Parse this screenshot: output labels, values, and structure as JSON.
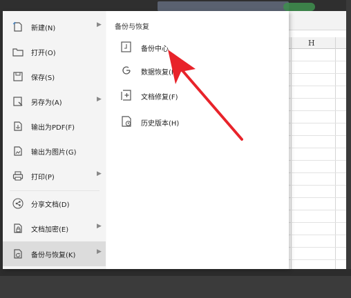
{
  "sheet": {
    "column_letter": "H"
  },
  "menu": {
    "items": [
      {
        "label": "新建(N)",
        "icon": "new-file-icon",
        "has_submenu": true
      },
      {
        "label": "打开(O)",
        "icon": "folder-icon",
        "has_submenu": false
      },
      {
        "label": "保存(S)",
        "icon": "save-icon",
        "has_submenu": false
      },
      {
        "label": "另存为(A)",
        "icon": "save-as-icon",
        "has_submenu": true
      },
      {
        "label": "输出为PDF(F)",
        "icon": "export-pdf-icon",
        "has_submenu": false
      },
      {
        "label": "输出为图片(G)",
        "icon": "export-image-icon",
        "has_submenu": false
      },
      {
        "label": "打印(P)",
        "icon": "printer-icon",
        "has_submenu": true
      },
      {
        "label": "分享文档(D)",
        "icon": "share-icon",
        "has_submenu": false
      },
      {
        "label": "文档加密(E)",
        "icon": "encrypt-icon",
        "has_submenu": true
      },
      {
        "label": "备份与恢复(K)",
        "icon": "backup-restore-icon",
        "has_submenu": true,
        "active": true
      }
    ],
    "submenu": {
      "title": "备份与恢复",
      "items": [
        {
          "label": "备份中心",
          "icon": "backup-center-icon"
        },
        {
          "label": "数据恢复(R)",
          "icon": "data-recovery-icon"
        },
        {
          "label": "文档修复(F)",
          "icon": "document-repair-icon"
        },
        {
          "label": "历史版本(H)",
          "icon": "history-version-icon"
        }
      ]
    }
  },
  "colors": {
    "menu_left_bg": "#f4f4f4",
    "active_item_bg": "#dcdcdc",
    "annotation_arrow": "#e8232a",
    "window_frame": "#2f2f2f"
  }
}
